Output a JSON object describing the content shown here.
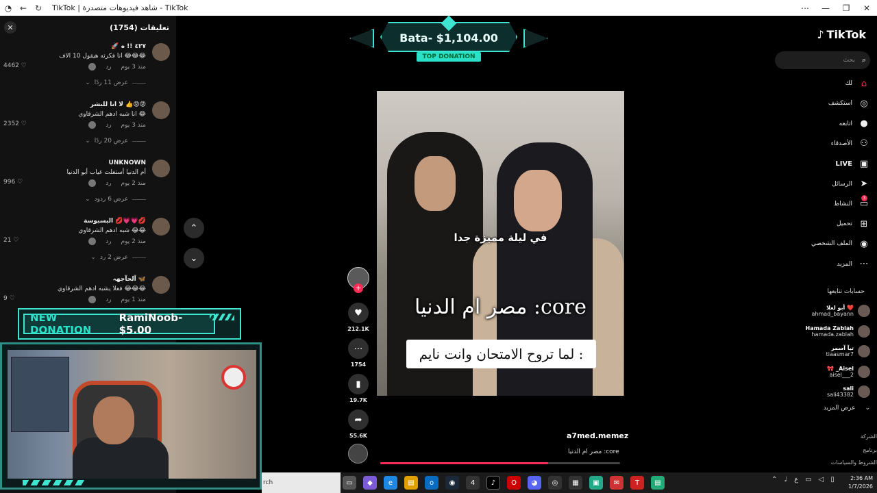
{
  "window": {
    "title": "TikTok | شاهد فيديوهات متصدرة - TikTok"
  },
  "comments": {
    "title": "تعليقات (1754)",
    "items": [
      {
        "user": "🚀 ٤٢٧ !! ه",
        "text": "انا فكرته هيقول 10 الاف 😂😂😂",
        "time": "منذ 3 يوم",
        "reply": "رد",
        "likes": "4462",
        "replies": "عرض 11 ردًا"
      },
      {
        "user": "لا انا للبشر 👍😡😡",
        "text": "انا شبه ادهم الشرقاوي 😂",
        "time": "منذ 3 يوم",
        "reply": "رد",
        "likes": "2352",
        "replies": "عرض 20 ردًا"
      },
      {
        "user": "UNKNOWN",
        "text": "أم الدنيا أستغلت غياب أبو الدنيا",
        "time": "منذ 2 يوم",
        "reply": "رد",
        "likes": "996",
        "replies": "عرض 6 ردود"
      },
      {
        "user": "البسبوسة 💋💗💗💋",
        "text": "شبه ادهم الشرقاوي 😂😂",
        "time": "منذ 2 يوم",
        "reply": "رد",
        "likes": "21",
        "replies": "عرض 2 رد"
      },
      {
        "user": "آلحآجهہ 🦋",
        "text": "فعلا يشبه ادهم الشرقاوي 😂😂😂",
        "time": "منذ 1 يوم",
        "reply": "رد",
        "likes": "9",
        "replies": ""
      }
    ]
  },
  "donation_top": {
    "amount": "Bata- $1,104.00",
    "label": "TOP DONATION"
  },
  "donation_new": {
    "tag": "NEW DONATION",
    "text": "RamiNoob- $5.00"
  },
  "video": {
    "caption_small": "في ليلة مميزة جدا",
    "caption_core": "مصر ام الدنيا :core",
    "caption_box": "لما تروح الامتحان وانت نايم :",
    "author": "a7med.memez",
    "description": "مصر ام الدنيا :core",
    "progress": 0.7
  },
  "actions": {
    "likes": "212.1K",
    "comments": "1754",
    "saves": "19.7K",
    "shares": "55.6K"
  },
  "sidebar": {
    "logo": "TikTok",
    "search_placeholder": "بحث",
    "nav": [
      {
        "label": "لك",
        "icon": "home-icon"
      },
      {
        "label": "استكشف",
        "icon": "compass-icon"
      },
      {
        "label": "اتابعه",
        "icon": "avatar-icon"
      },
      {
        "label": "الأصدقاء",
        "icon": "friends-icon"
      },
      {
        "label": "LIVE",
        "icon": "live-icon"
      },
      {
        "label": "الرسائل",
        "icon": "send-icon"
      },
      {
        "label": "النشاط",
        "icon": "activity-icon",
        "badge": "3"
      },
      {
        "label": "تحميل",
        "icon": "upload-icon"
      },
      {
        "label": "الملف الشخصي",
        "icon": "profile-icon"
      },
      {
        "label": "المزيد",
        "icon": "more-icon"
      }
    ],
    "following_title": "حسابات تتابعها",
    "following": [
      {
        "name": "أبو لعلا ❤️",
        "handle": "ahmad_bayann"
      },
      {
        "name": "Hamada Zablah",
        "handle": "hamada.zablah"
      },
      {
        "name": "تيآ آسمر",
        "handle": "tiaasmar7"
      },
      {
        "name": "🎀 _Aisel",
        "handle": "aisel___2"
      },
      {
        "name": "sali",
        "handle": "sali43382"
      }
    ],
    "see_more": "عرض المزيد",
    "footer": [
      "الشركة",
      "برنامج",
      "الشروط والسياسات"
    ]
  },
  "taskbar": {
    "search_label": "rch",
    "time": "2:36 AM",
    "date": "1/7/2026",
    "lang": "ع"
  }
}
